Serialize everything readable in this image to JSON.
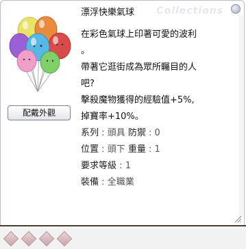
{
  "window": {
    "title": "漂浮快樂氣球",
    "watermark": "Collections"
  },
  "buttons": {
    "view_appearance": "配戴外觀"
  },
  "description": {
    "lines": [
      "在彩色氣球上印著可愛的波利",
      "。",
      "帶著它逛街成為眾所矚目的人",
      "吧?",
      "擊殺魔物獲得的經驗值+5%,",
      "掉寶率+10%。"
    ]
  },
  "attributes": {
    "series_label": "系列",
    "series_value": "頭具",
    "defense_label": "防禦",
    "defense_value": "0",
    "position_label": "位置",
    "position_value": "頭下",
    "weight_label": "重量",
    "weight_value": "1",
    "level_label": "要求等級",
    "level_value": "1",
    "equip_label": "裝備",
    "equip_value": "全職業",
    "separator": ":"
  },
  "card_slots": {
    "count": 4
  },
  "colors": {
    "frame_border": "#b9bcc4",
    "bottom_border": "#4a3a2b",
    "slot_fill": "#c7a7ab"
  }
}
